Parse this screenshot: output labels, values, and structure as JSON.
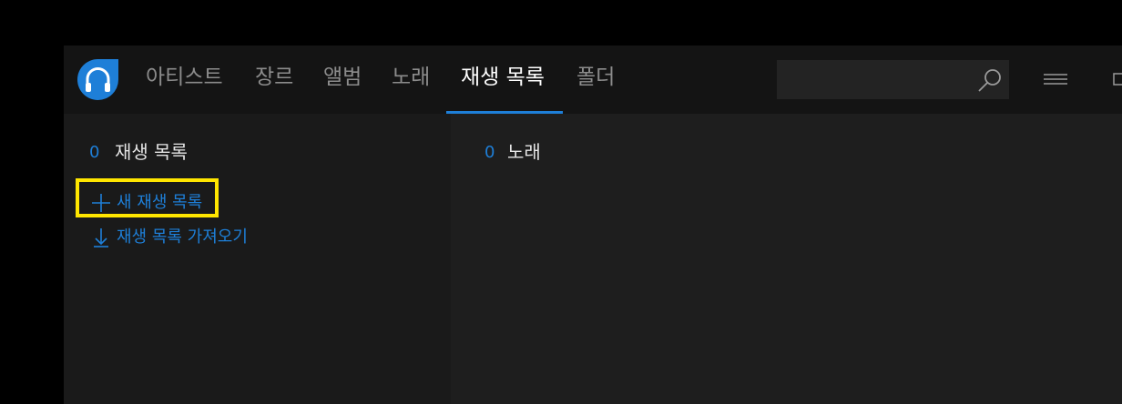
{
  "colors": {
    "accent": "#1e7fd8",
    "highlight": "#ffe600",
    "tab_inactive": "#8c8c8c",
    "tab_active": "#ffffff"
  },
  "header": {
    "logo_icon": "headphones-logo-icon",
    "tabs": [
      {
        "label": "아티스트",
        "active": false
      },
      {
        "label": "장르",
        "active": false
      },
      {
        "label": "앨범",
        "active": false
      },
      {
        "label": "노래",
        "active": false
      },
      {
        "label": "재생 목록",
        "active": true
      },
      {
        "label": "폴더",
        "active": false
      }
    ],
    "search": {
      "value": "",
      "placeholder": ""
    },
    "icons": [
      "search-icon",
      "hamburger-menu-icon"
    ]
  },
  "left_panel": {
    "count": "0",
    "title": "재생 목록",
    "actions": [
      {
        "icon": "plus-icon",
        "label": "새 재생 목록"
      },
      {
        "icon": "download-arrow-icon",
        "label": "재생 목록 가져오기"
      }
    ]
  },
  "right_panel": {
    "count": "0",
    "title": "노래"
  }
}
